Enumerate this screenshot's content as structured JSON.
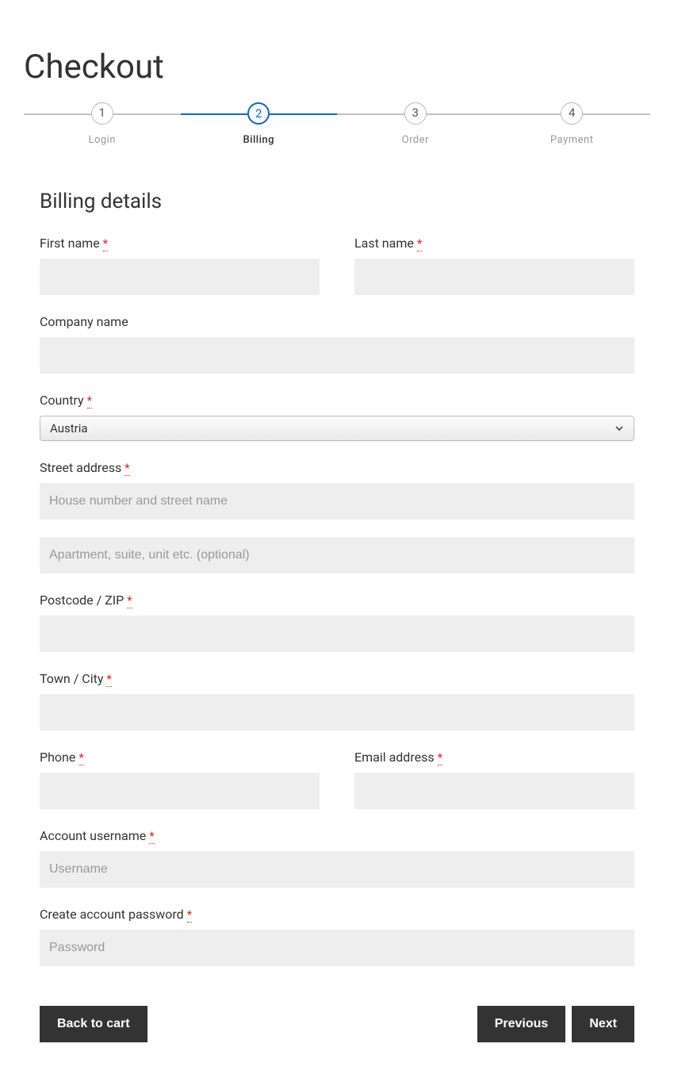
{
  "pageTitle": "Checkout",
  "steps": [
    {
      "num": "1",
      "label": "Login"
    },
    {
      "num": "2",
      "label": "Billing"
    },
    {
      "num": "3",
      "label": "Order"
    },
    {
      "num": "4",
      "label": "Payment"
    }
  ],
  "activeStepIndex": 1,
  "section": {
    "title": "Billing details"
  },
  "fields": {
    "firstName": {
      "label": "First name ",
      "required": "*"
    },
    "lastName": {
      "label": "Last name ",
      "required": "*"
    },
    "company": {
      "label": "Company name"
    },
    "country": {
      "label": "Country ",
      "required": "*",
      "value": "Austria"
    },
    "street": {
      "label": "Street address ",
      "required": "*",
      "placeholder1": "House number and street name",
      "placeholder2": "Apartment, suite, unit etc. (optional)"
    },
    "postcode": {
      "label": "Postcode / ZIP ",
      "required": "*"
    },
    "town": {
      "label": "Town / City ",
      "required": "*"
    },
    "phone": {
      "label": "Phone ",
      "required": "*"
    },
    "email": {
      "label": "Email address ",
      "required": "*"
    },
    "username": {
      "label": "Account username ",
      "required": "*",
      "placeholder": "Username"
    },
    "password": {
      "label": "Create account password ",
      "required": "*",
      "placeholder": "Password"
    }
  },
  "buttons": {
    "back": "Back to cart",
    "previous": "Previous",
    "next": "Next"
  }
}
